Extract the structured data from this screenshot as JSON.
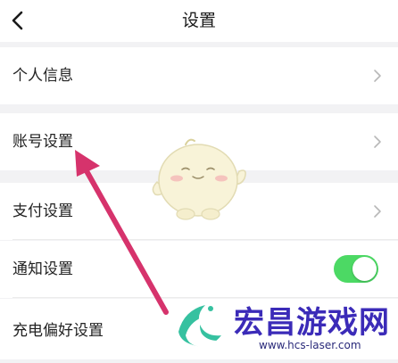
{
  "header": {
    "title": "设置",
    "back_icon": "chevron-left-icon"
  },
  "settings": {
    "items": [
      {
        "label": "个人信息",
        "control": "chevron"
      },
      {
        "label": "账号设置",
        "control": "chevron"
      },
      {
        "label": "支付设置",
        "control": "chevron"
      },
      {
        "label": "通知设置",
        "control": "toggle",
        "toggle_on": true
      },
      {
        "label": "充电偏好设置",
        "control": "none"
      }
    ]
  },
  "watermark": {
    "text": "宏昌游戏网",
    "url": "www.hcs-laser.com"
  },
  "colors": {
    "toggle_on": "#4cd964",
    "arrow": "#d6336c",
    "watermark": "#3b2bb8",
    "background": "#f2f2f4"
  }
}
